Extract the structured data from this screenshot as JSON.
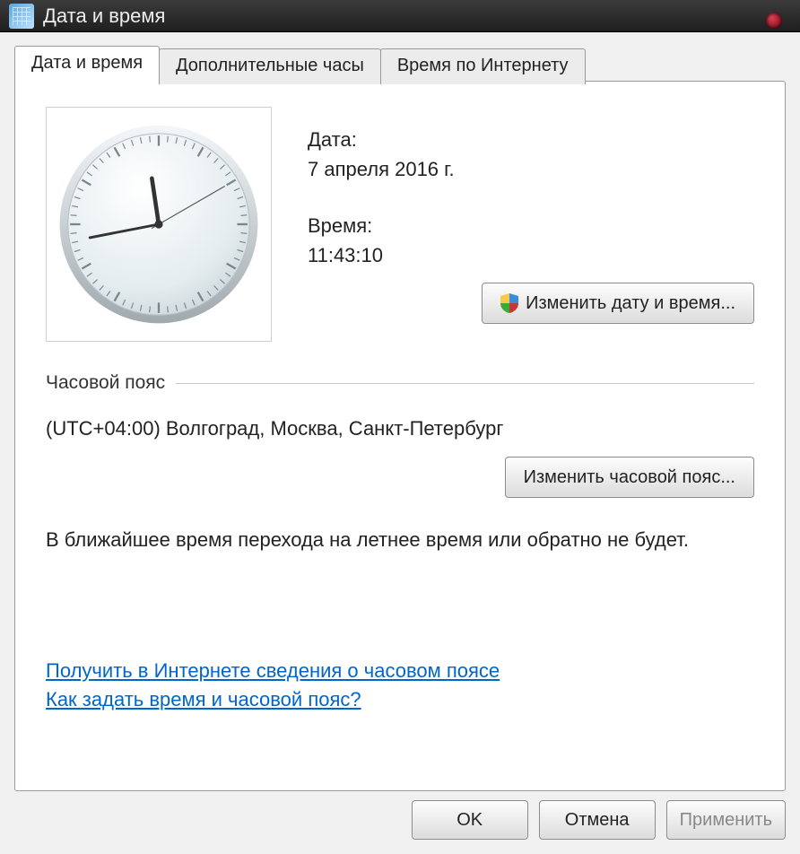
{
  "window": {
    "title": "Дата и время"
  },
  "tabs": {
    "date_time": "Дата и время",
    "additional": "Дополнительные часы",
    "internet": "Время по Интернету"
  },
  "info": {
    "date_label": "Дата:",
    "date_value": "7 апреля 2016 г.",
    "time_label": "Время:",
    "time_value": "11:43:10"
  },
  "clock": {
    "hours": 11,
    "minutes": 43,
    "seconds": 10
  },
  "buttons": {
    "change_datetime": "Изменить дату и время...",
    "change_timezone": "Изменить часовой пояс...",
    "ok": "OK",
    "cancel": "Отмена",
    "apply": "Применить"
  },
  "timezone": {
    "section_label": "Часовой пояс",
    "value": "(UTC+04:00) Волгоград, Москва, Санкт-Петербург",
    "dst_note": "В ближайшее время перехода на летнее время или обратно не будет."
  },
  "links": {
    "tz_info": "Получить в Интернете сведения о часовом поясе",
    "how_set": "Как задать время и часовой пояс?"
  }
}
